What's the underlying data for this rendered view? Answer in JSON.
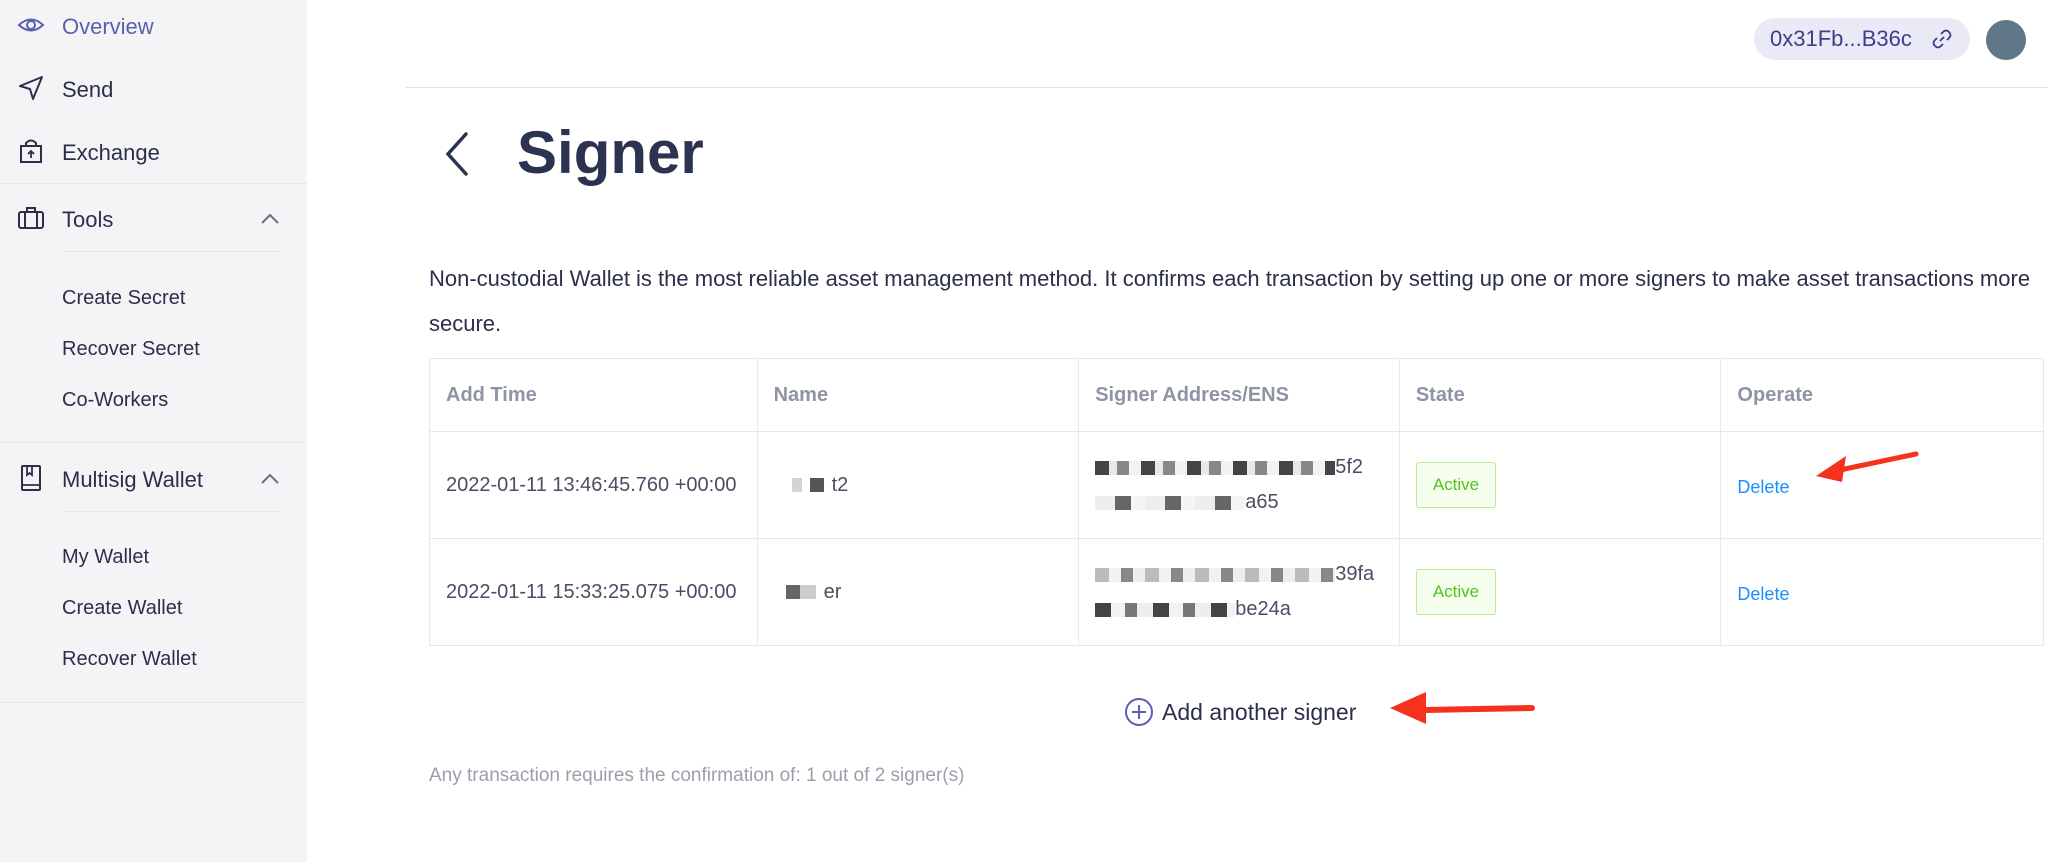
{
  "sidebar": {
    "overview": "Overview",
    "send": "Send",
    "exchange": "Exchange",
    "tools": "Tools",
    "tools_items": [
      "Create Secret",
      "Recover Secret",
      "Co-Workers"
    ],
    "multisig": "Multisig Wallet",
    "multisig_items": [
      "My Wallet",
      "Create Wallet",
      "Recover Wallet"
    ],
    "icons": {
      "overview": "eye-icon",
      "send": "send-icon",
      "exchange": "shopping-bag-icon",
      "tools": "toolbox-icon",
      "multisig": "book-icon"
    }
  },
  "header": {
    "address": "0x31Fb...B36c",
    "link_icon": "link-icon"
  },
  "main": {
    "title": "Signer",
    "description": "Non-custodial Wallet is the most reliable asset management method. It confirms each transaction by setting up one or more signers to make asset transactions more secure.",
    "table": {
      "headers": [
        "Add Time",
        "Name",
        "Signer Address/ENS",
        "State",
        "Operate"
      ],
      "rows": [
        {
          "time": "2022-01-11 13:46:45.760 +00:00",
          "name_suffix": "t2",
          "address_line1_suffix": "5f2",
          "address_line2_suffix": "a65",
          "state": "Active",
          "operate": "Delete"
        },
        {
          "time": "2022-01-11 15:33:25.075 +00:00",
          "name_suffix": "er",
          "address_line1_suffix": "39fa",
          "address_line2_suffix": "be24a",
          "state": "Active",
          "operate": "Delete"
        }
      ]
    },
    "add_signer": "Add another signer",
    "note": "Any transaction requires the confirmation of: 1 out of 2 signer(s)"
  },
  "colors": {
    "accent": "#5a5fb0",
    "sidebar_bg": "#f4f4f6",
    "annotation_arrow": "#f5321e",
    "active_green": "#52c41a",
    "link_blue": "#1890ff"
  }
}
